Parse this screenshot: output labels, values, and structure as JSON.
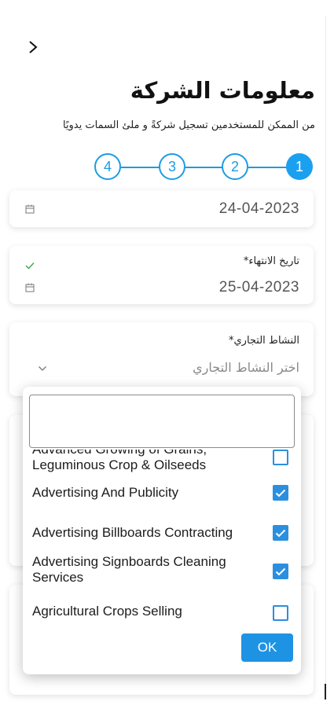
{
  "header": {
    "back_icon": "chevron-right-icon",
    "title": "معلومات الشركة",
    "subtitle": "من الممكن للمستخدمين تسجيل شركةً و ملئ السمات يدويًا"
  },
  "stepper": {
    "steps": [
      "1",
      "2",
      "3",
      "4"
    ],
    "active_step": 1,
    "accent_color": "#1ba0f0"
  },
  "start_date": {
    "value": "24-04-2023",
    "icon": "calendar-icon"
  },
  "end_date": {
    "label": "تاريخ الانتهاء*",
    "value": "25-04-2023",
    "status_icon": "check-icon",
    "icon": "calendar-icon"
  },
  "business_activity": {
    "label": "النشاط التجاري*",
    "placeholder": "اختر النشاط التجاري",
    "icon": "chevron-down-icon"
  },
  "dropdown": {
    "search_value": "",
    "options": [
      {
        "label": "Advanced Growing of Grains, Leguminous Crop & Oilseeds",
        "checked": false
      },
      {
        "label": "Advertising And Publicity",
        "checked": true
      },
      {
        "label": "Advertising Billboards Contracting",
        "checked": true
      },
      {
        "label": "Advertising Signboards Cleaning Services",
        "checked": true
      },
      {
        "label": "Agricultural Crops Selling",
        "checked": false
      }
    ],
    "ok_label": "OK",
    "check_color": "#2b8fe0"
  }
}
